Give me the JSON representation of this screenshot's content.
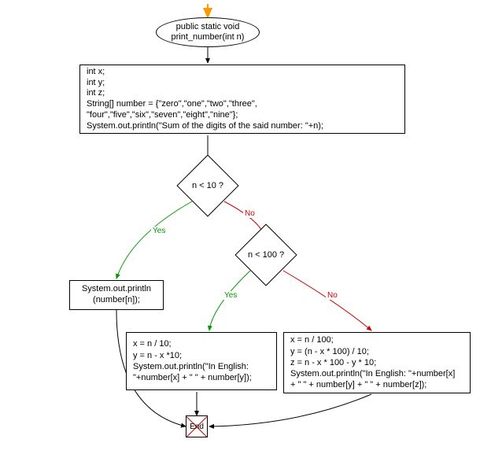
{
  "flow": {
    "start": "public static void\nprint_number(int n)",
    "decl": "int x;\nint y;\nint z;\nString[] number = {\"zero\",\"one\",\"two\",\"three\",\n\"four\",\"five\",\"six\",\"seven\",\"eight\",\"nine\"};\nSystem.out.println(\"Sum of the digits of the said number: \"+n);",
    "cond1": "n < 10 ?",
    "cond2": "n < 100 ?",
    "out1": "System.out.println\n(number[n]);",
    "out2": "x = n / 10;\ny = n - x *10;\nSystem.out.println(\"In English:\n\"+number[x] + \" \" + number[y]);",
    "out3": "x = n / 100;\ny = (n - x * 100) / 10;\nz = n - x * 100 - y * 10;\nSystem.out.println(\"In English: \"+number[x]\n+ \" \" + number[y] + \" \" + number[z]);",
    "end": "End",
    "yes": "Yes",
    "no": "No"
  }
}
